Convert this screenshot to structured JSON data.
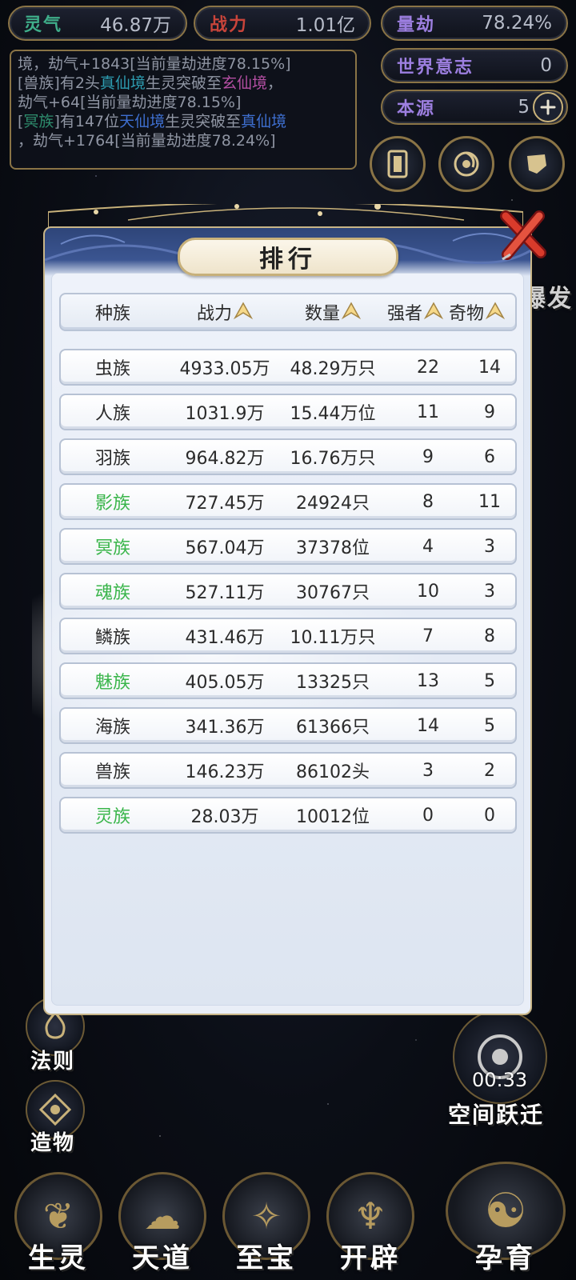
{
  "stats": {
    "lingqi": {
      "label": "灵气",
      "value": "46.87万"
    },
    "zhanli": {
      "label": "战力",
      "value": "1.01亿"
    },
    "liangjie": {
      "label": "量劫",
      "value": "78.24%"
    },
    "world_will": {
      "label": "世界意志",
      "value": "0"
    },
    "benyuan": {
      "label": "本源",
      "value": "5"
    }
  },
  "log": {
    "line1": "境，劫气+1843[当前量劫进度78.15%]",
    "line2a": "[兽族]有2头",
    "line2b": "真仙境",
    "line2c": "生灵突破至",
    "line2d": "玄仙境",
    "line2e": "，",
    "line3": "劫气+64[当前量劫进度78.15%]",
    "line4a": "[",
    "line4b": "冥族",
    "line4c": "]有147位",
    "line4d": "天仙境",
    "line4e": "生灵突破至",
    "line4f": "真仙境",
    "line5": "，劫气+1764[当前量劫进度78.24%]"
  },
  "modal": {
    "title": "排行",
    "columns": [
      "种族",
      "战力",
      "数量",
      "强者",
      "奇物"
    ],
    "rows": [
      {
        "race": "虫族",
        "power": "4933.05万",
        "count": "48.29万只",
        "strong": "22",
        "treasure": "14",
        "green": false
      },
      {
        "race": "人族",
        "power": "1031.9万",
        "count": "15.44万位",
        "strong": "11",
        "treasure": "9",
        "green": false
      },
      {
        "race": "羽族",
        "power": "964.82万",
        "count": "16.76万只",
        "strong": "9",
        "treasure": "6",
        "green": false
      },
      {
        "race": "影族",
        "power": "727.45万",
        "count": "24924只",
        "strong": "8",
        "treasure": "11",
        "green": true
      },
      {
        "race": "冥族",
        "power": "567.04万",
        "count": "37378位",
        "strong": "4",
        "treasure": "3",
        "green": true
      },
      {
        "race": "魂族",
        "power": "527.11万",
        "count": "30767只",
        "strong": "10",
        "treasure": "3",
        "green": true
      },
      {
        "race": "鳞族",
        "power": "431.46万",
        "count": "10.11万只",
        "strong": "7",
        "treasure": "8",
        "green": false
      },
      {
        "race": "魅族",
        "power": "405.05万",
        "count": "13325只",
        "strong": "13",
        "treasure": "5",
        "green": true
      },
      {
        "race": "海族",
        "power": "341.36万",
        "count": "61366只",
        "strong": "14",
        "treasure": "5",
        "green": false
      },
      {
        "race": "兽族",
        "power": "146.23万",
        "count": "86102头",
        "strong": "3",
        "treasure": "2",
        "green": false
      },
      {
        "race": "灵族",
        "power": "28.03万",
        "count": "10012位",
        "strong": "0",
        "treasure": "0",
        "green": true
      }
    ]
  },
  "side": {
    "partial_right": "爆发",
    "fa_ze": "法则",
    "zao_wu": "造物",
    "timer": "00:33",
    "space_jump": "空间跃迁"
  },
  "bottom": {
    "shengling": "生灵",
    "tiandao": "天道",
    "zhibao": "至宝",
    "kaipi": "开辟",
    "yunyu": "孕育"
  },
  "colors": {
    "accent_gold": "#8a7446",
    "race_green": "#39b54a"
  }
}
